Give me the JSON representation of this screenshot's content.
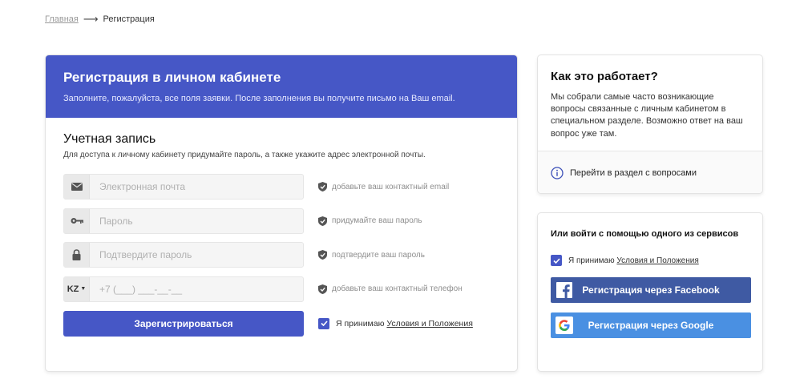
{
  "breadcrumb": {
    "home": "Главная",
    "current": "Регистрация"
  },
  "main": {
    "title": "Регистрация в личном кабинете",
    "subtitle": "Заполните, пожалуйста, все поля заявки. После заполнения вы получите письмо на Ваш email.",
    "section_title": "Учетная запись",
    "section_desc": "Для доступа к личному кабинету придумайте пароль, а также укажите адрес электронной почты.",
    "fields": {
      "email": {
        "placeholder": "Электронная почта",
        "hint": "добавьте ваш контактный email",
        "icon": "envelope-icon"
      },
      "password": {
        "placeholder": "Пароль",
        "hint": "придумайте ваш пароль",
        "icon": "key-icon"
      },
      "confirm": {
        "placeholder": "Подтвердите пароль",
        "hint": "подтвердите ваш пароль",
        "icon": "lock-icon"
      },
      "phone": {
        "country": "KZ",
        "placeholder": "+7 (___) ___-__-__",
        "hint": "добавьте ваш контактный телефон"
      }
    },
    "submit_label": "Зарегистрироваться",
    "agree_text": "Я принимаю",
    "terms_link": "Условия и Положения"
  },
  "how": {
    "title": "Как это работает?",
    "text": "Мы собрали самые часто возникающие вопросы связанные с личным кабинетом в специальном разделе. Возможно ответ на ваш вопрос уже там.",
    "link": "Перейти в раздел с вопросами"
  },
  "social": {
    "title": "Или войти с помощью одного из сервисов",
    "agree_text": "Я принимаю",
    "terms_link": "Условия и Положения",
    "facebook_label": "Регистрация через Facebook",
    "google_label": "Регистрация через Google"
  },
  "colors": {
    "primary": "#4657c6",
    "facebook": "#3f5aa3",
    "google": "#4a90e2"
  }
}
